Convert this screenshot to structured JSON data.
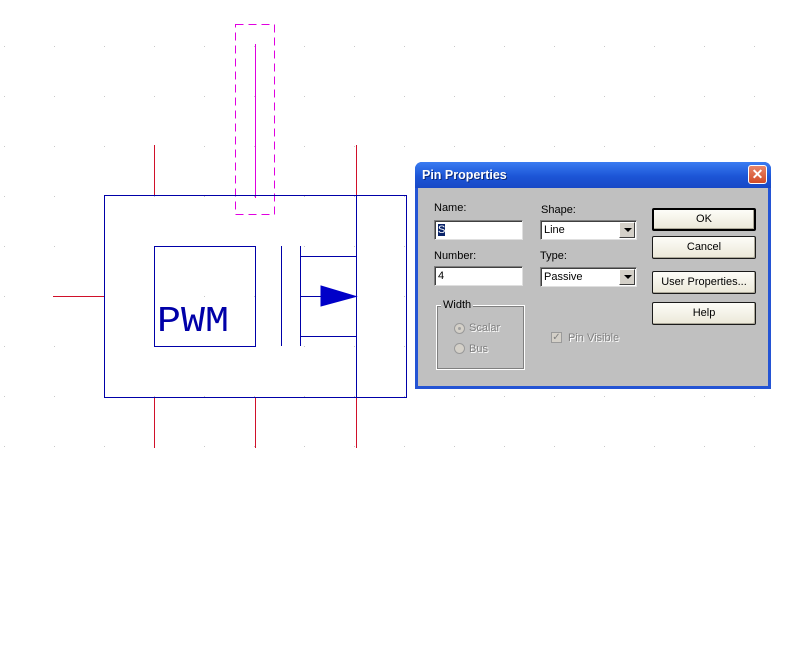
{
  "schematic": {
    "component_label": "PWM",
    "colors": {
      "body": "#0000a8",
      "pin": "#d0102a",
      "selected_pin": "#e000e0",
      "grid_dot": "#c8c8c8"
    }
  },
  "dialog": {
    "title": "Pin Properties",
    "close_icon": "close-icon",
    "name_label": "Name:",
    "name_value": "S",
    "number_label": "Number:",
    "number_value": "4",
    "shape_label": "Shape:",
    "shape_value": "Line",
    "type_label": "Type:",
    "type_value": "Passive",
    "width_group_label": "Width",
    "radio_scalar": "Scalar",
    "radio_bus": "Bus",
    "pin_visible_label": "Pin Visible",
    "ok_label": "OK",
    "cancel_label": "Cancel",
    "user_properties_label": "User Properties...",
    "help_label": "Help"
  }
}
